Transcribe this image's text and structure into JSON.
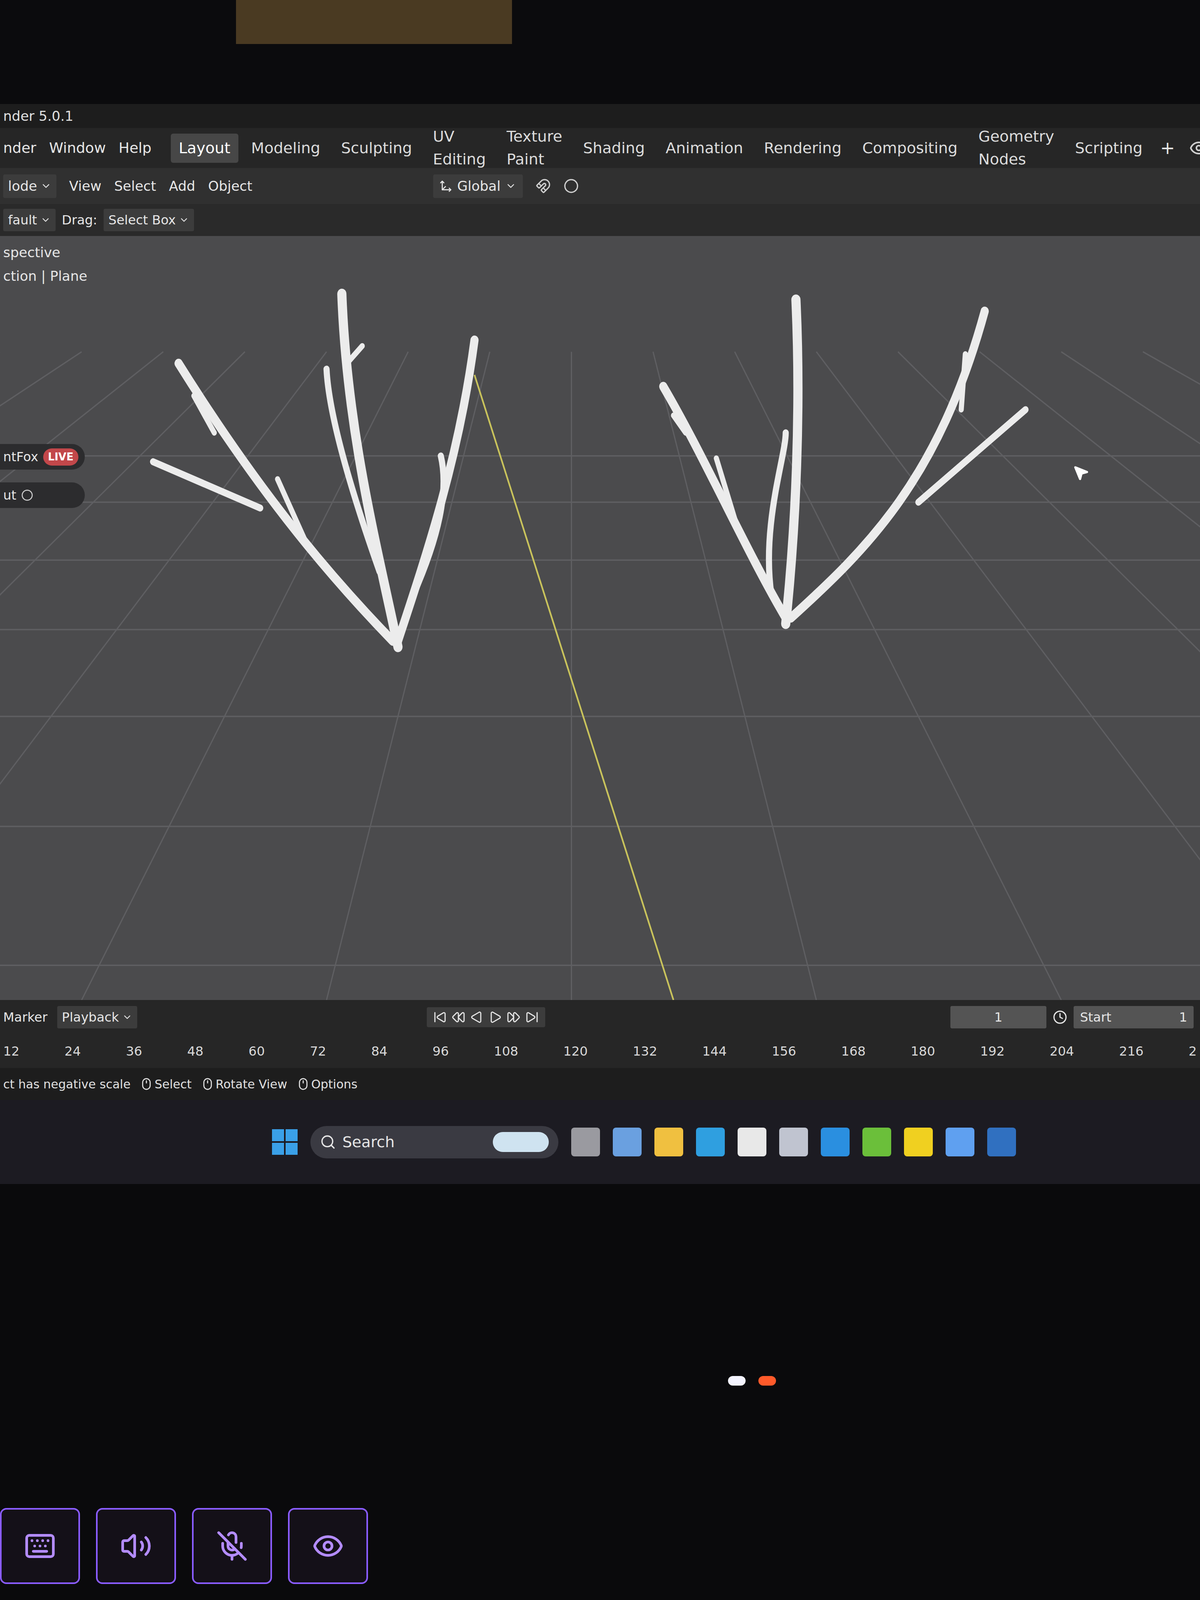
{
  "window": {
    "title": "nder 5.0.1"
  },
  "menus": [
    "nder",
    "Window",
    "Help"
  ],
  "workspaces": [
    {
      "label": "Layout",
      "selected": true
    },
    {
      "label": "Modeling",
      "selected": false
    },
    {
      "label": "Sculpting",
      "selected": false
    },
    {
      "label": "UV Editing",
      "selected": false
    },
    {
      "label": "Texture Paint",
      "selected": false
    },
    {
      "label": "Shading",
      "selected": false
    },
    {
      "label": "Animation",
      "selected": false
    },
    {
      "label": "Rendering",
      "selected": false
    },
    {
      "label": "Compositing",
      "selected": false
    },
    {
      "label": "Geometry Nodes",
      "selected": false
    },
    {
      "label": "Scripting",
      "selected": false
    }
  ],
  "add_workspace": "+",
  "header": {
    "mode": "lode",
    "menus": [
      "View",
      "Select",
      "Add",
      "Object"
    ],
    "orientation": "Global"
  },
  "tool_settings": {
    "preset": "fault",
    "drag_label": "Drag:",
    "drag_value": "Select Box"
  },
  "viewport": {
    "overlay": [
      "spective",
      "ction | Plane"
    ],
    "side_items": [
      {
        "label": "ntFox",
        "badge": "LIVE"
      },
      {
        "label": "ut",
        "badge": ""
      }
    ]
  },
  "timeline": {
    "menus": [
      "Marker",
      "Playback"
    ],
    "frames": [
      "12",
      "24",
      "36",
      "48",
      "60",
      "72",
      "84",
      "96",
      "108",
      "120",
      "132",
      "144",
      "156",
      "168",
      "180",
      "192",
      "204",
      "216",
      "2"
    ],
    "current_frame": "1",
    "start_label": "Start",
    "start_value": "1"
  },
  "status_bar": {
    "message": "ct has negative scale",
    "hints": [
      "Select",
      "Rotate View",
      "Options"
    ]
  },
  "taskbar": {
    "search": "Search"
  }
}
